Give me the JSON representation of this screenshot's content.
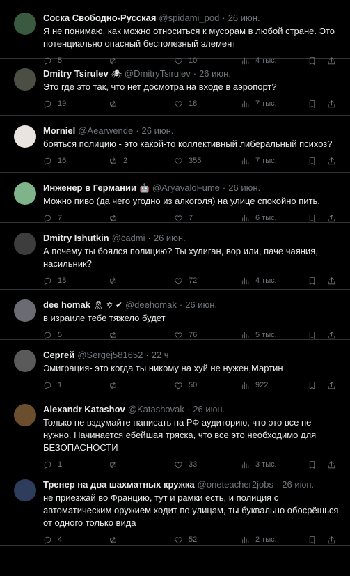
{
  "tweets": [
    {
      "name": "Соска Свободно-Русская",
      "handle": "@spidami_pod",
      "time": "26 июн.",
      "text": "Я не понимаю, как можно относиться к мусорам в любой стране. Это потенциально опасный бесполезный элемент",
      "replies": "5",
      "retweets": "",
      "likes": "10",
      "views": "4 тыс.",
      "avatar_color": "#3a5a3f",
      "badge": ""
    },
    {
      "name": "Dmitry Tsirulev",
      "handle": "@DmitryTsirulev",
      "time": "26 июн.",
      "text": "Это где это так, что нет досмотра на входе в аэропорт?",
      "replies": "19",
      "retweets": "",
      "likes": "18",
      "views": "7 тыс.",
      "avatar_color": "#4a4f44",
      "badge": "🕷"
    },
    {
      "name": "Morniel",
      "handle": "@Aearwende",
      "time": "26 июн.",
      "text": "бояться полицию - это какой-то коллективный либеральный психоз?",
      "replies": "16",
      "retweets": "2",
      "likes": "355",
      "views": "7 тыс.",
      "avatar_color": "#e9e4df",
      "badge": ""
    },
    {
      "name": "Инженер в Германии",
      "handle": "@AryavaloFume",
      "time": "26 июн.",
      "text": "Можно пиво (да чего угодно из алкоголя) на улице спокойно пить.",
      "replies": "7",
      "retweets": "",
      "likes": "7",
      "views": "6 тыс.",
      "avatar_color": "#7fb38a",
      "badge": "🤖"
    },
    {
      "name": "Dmitry Ishutkin",
      "handle": "@cadmi",
      "time": "26 июн.",
      "text": "А почему ты боялся полицию? Ты хулиган, вор или, паче чаяния, насильник?",
      "replies": "18",
      "retweets": "",
      "likes": "72",
      "views": "4 тыс.",
      "avatar_color": "#3d3d3d",
      "badge": ""
    },
    {
      "name": "dee homak",
      "handle": "@deehomak",
      "time": "26 июн.",
      "text": "в израиле тебе тяжело будет",
      "replies": "5",
      "retweets": "",
      "likes": "76",
      "views": "5 тыс.",
      "avatar_color": "#6b6b74",
      "badge": "🎗 ✡ ✔"
    },
    {
      "name": "Сергей",
      "handle": "@Sergej581652",
      "time": "22 ч",
      "text": "Эмиграция- это когда ты никому на хуй не нужен,Мартин",
      "replies": "1",
      "retweets": "",
      "likes": "50",
      "views": "922",
      "avatar_color": "#5a5a5a",
      "badge": ""
    },
    {
      "name": "Alexandr Katashov",
      "handle": "@Katashovak",
      "time": "26 июн.",
      "text": "Только не вздумайте написать на РФ аудиторию, что это все не нужно. Начинается ебейшая тряска, что все это необходимо для БЕЗОПАСНОСТИ",
      "replies": "1",
      "retweets": "",
      "likes": "33",
      "views": "3 тыс.",
      "avatar_color": "#6b4e2e",
      "badge": ""
    },
    {
      "name": "Тренер на два шахматных кружка",
      "handle": "@oneteacher2jobs",
      "time": "26 июн.",
      "text": "не приезжай во Францию, тут и рамки есть, и полиция с автоматическим оружием ходит по улицам, ты буквально обосрёшься от одного только вида",
      "replies": "4",
      "retweets": "",
      "likes": "52",
      "views": "2 тыс.",
      "avatar_color": "#2e3d5c",
      "badge": ""
    }
  ]
}
